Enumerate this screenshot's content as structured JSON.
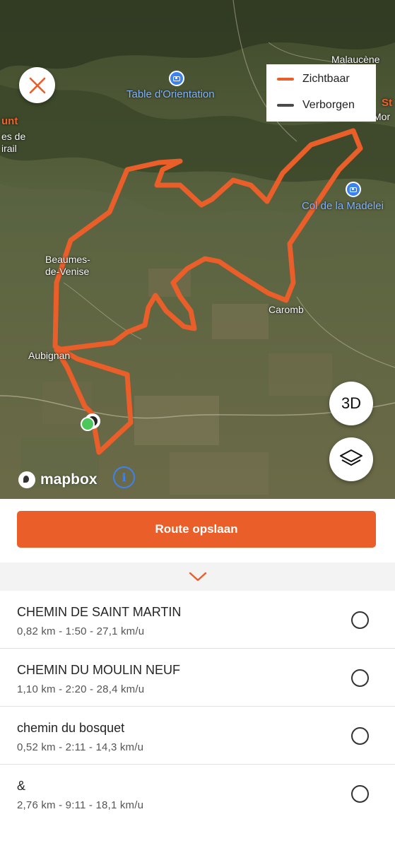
{
  "map": {
    "places": {
      "malaucene": "Malaucène",
      "beaumes": "Beaumes-\nde-Venise",
      "aubignan": "Aubignan",
      "caromb": "Caromb",
      "left_edge": "es de\nirail",
      "mor": "Mor"
    },
    "orange_labels": {
      "unt": "unt",
      "st": "St"
    },
    "pois": {
      "table": "Table d'Orientation",
      "col": "Col de la Madelei"
    },
    "attribution": "mapbox",
    "info_glyph": "i"
  },
  "legend": {
    "items": [
      {
        "label": "Zichtbaar",
        "color": "#ea5e2a"
      },
      {
        "label": "Verborgen",
        "color": "#4a4a4a"
      }
    ]
  },
  "controls": {
    "close_icon": "close-icon",
    "btn_3d": "3D",
    "layers_icon": "layers-icon"
  },
  "save_button": {
    "label": "Route opslaan",
    "color": "#ea5e2a"
  },
  "segments": [
    {
      "name": "CHEMIN DE SAINT MARTIN",
      "stats": "0,82 km - 1:50 - 27,1 km/u"
    },
    {
      "name": "CHEMIN DU MOULIN NEUF",
      "stats": "1,10 km - 2:20 - 28,4 km/u"
    },
    {
      "name": "chemin du bosquet",
      "stats": "0,52 km - 2:11 - 14,3 km/u"
    },
    {
      "name": "&",
      "stats": "2,76 km - 9:11 - 18,1 km/u"
    }
  ]
}
